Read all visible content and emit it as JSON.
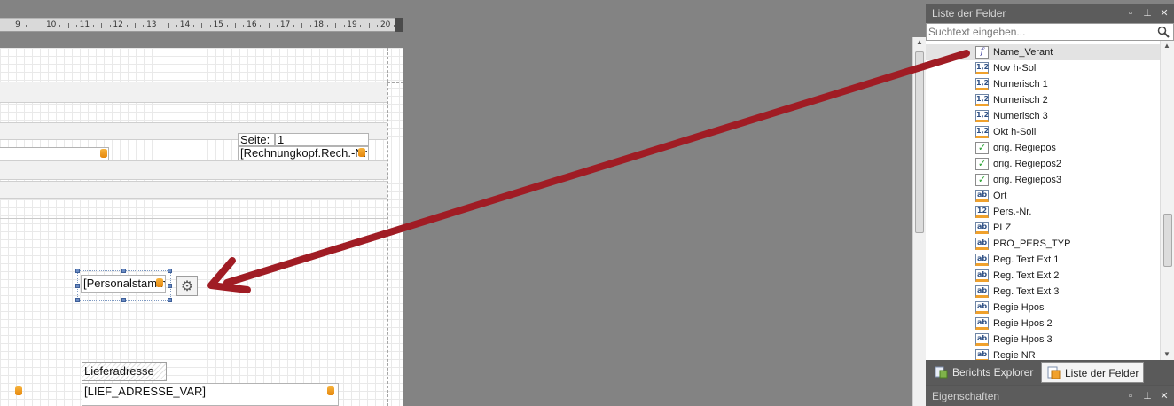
{
  "ruler": {
    "numbers": [
      "9",
      "10",
      "11",
      "12",
      "13",
      "14",
      "15",
      "16",
      "17",
      "18",
      "19",
      "20"
    ]
  },
  "report": {
    "page_label": "Seite:",
    "page_number": "1",
    "rech_field": "[Rechnungkopf.Rech.-Nr",
    "personal_field": "[Personalstamm",
    "lieferadresse_label": "Lieferadresse",
    "lief_adresse_field": "[LIEF_ADRESSE_VAR]"
  },
  "field_list": {
    "title": "Liste der Felder",
    "search_placeholder": "Suchtext eingeben...",
    "items": [
      {
        "label": "Name_Verant",
        "icon": "fx"
      },
      {
        "label": "Nov h-Soll",
        "icon": "1,2"
      },
      {
        "label": "Numerisch 1",
        "icon": "1,2"
      },
      {
        "label": "Numerisch 2",
        "icon": "1,2"
      },
      {
        "label": "Numerisch 3",
        "icon": "1,2"
      },
      {
        "label": "Okt h-Soll",
        "icon": "1,2"
      },
      {
        "label": "orig. Regiepos",
        "icon": "check"
      },
      {
        "label": "orig. Regiepos2",
        "icon": "check"
      },
      {
        "label": "orig. Regiepos3",
        "icon": "check"
      },
      {
        "label": "Ort",
        "icon": "ab"
      },
      {
        "label": "Pers.-Nr.",
        "icon": "12"
      },
      {
        "label": "PLZ",
        "icon": "ab"
      },
      {
        "label": "PRO_PERS_TYP",
        "icon": "ab"
      },
      {
        "label": "Reg. Text Ext 1",
        "icon": "ab"
      },
      {
        "label": "Reg. Text Ext 2",
        "icon": "ab"
      },
      {
        "label": "Reg. Text Ext 3",
        "icon": "ab"
      },
      {
        "label": "Regie Hpos",
        "icon": "ab"
      },
      {
        "label": "Regie Hpos 2",
        "icon": "ab"
      },
      {
        "label": "Regie Hpos 3",
        "icon": "ab"
      },
      {
        "label": "Regie NR",
        "icon": "ab"
      }
    ]
  },
  "tabs": {
    "explorer": "Berichts Explorer",
    "field_list": "Liste der Felder"
  },
  "properties": {
    "title": "Eigenschaften"
  },
  "colors": {
    "arrow": "#a01c24",
    "panel_bg": "#555555",
    "workspace": "#838383"
  }
}
